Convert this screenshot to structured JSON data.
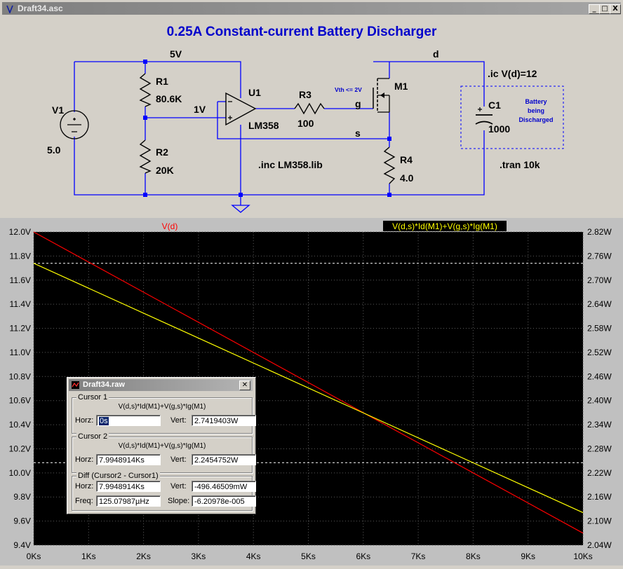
{
  "window": {
    "title": "Draft34.asc",
    "buttons": [
      "_",
      "□",
      "X"
    ]
  },
  "schematic": {
    "title": "0.25A Constant-current Battery Discharger",
    "labels": {
      "net_5v": "5V",
      "net_d": "d",
      "net_g": "g",
      "net_s": "s",
      "net_1v": "1V",
      "v1_name": "V1",
      "v1_value": "5.0",
      "r1_name": "R1",
      "r1_value": "80.6K",
      "r2_name": "R2",
      "r2_value": "20K",
      "u1_name": "U1",
      "u1_value": "LM358",
      "r3_name": "R3",
      "r3_value": "100",
      "m1_name": "M1",
      "vth_note": "Vth <= 2V",
      "r4_name": "R4",
      "r4_value": "4.0",
      "c1_name": "C1",
      "c1_value": "1000",
      "ic_directive": ".ic V(d)=12",
      "inc_directive": ".inc LM358.lib",
      "tran_directive": ".tran 10k",
      "battery_note_1": "Battery",
      "battery_note_2": "being",
      "battery_note_3": "Discharged"
    },
    "colors": {
      "wire": "#0000ff",
      "component": "#000000",
      "title": "#0000cc",
      "background": "#d4d0c8"
    }
  },
  "chart_data": {
    "type": "line",
    "x_ticks": [
      "0Ks",
      "1Ks",
      "2Ks",
      "3Ks",
      "4Ks",
      "5Ks",
      "6Ks",
      "7Ks",
      "8Ks",
      "9Ks",
      "10Ks"
    ],
    "x_range": [
      0,
      10
    ],
    "left_ticks": [
      "12.0V",
      "11.8V",
      "11.6V",
      "11.4V",
      "11.2V",
      "11.0V",
      "10.8V",
      "10.6V",
      "10.4V",
      "10.2V",
      "10.0V",
      "9.8V",
      "9.6V",
      "9.4V"
    ],
    "left_range": [
      9.4,
      12.0
    ],
    "right_ticks": [
      "2.82W",
      "2.76W",
      "2.70W",
      "2.64W",
      "2.58W",
      "2.52W",
      "2.46W",
      "2.40W",
      "2.34W",
      "2.28W",
      "2.22W",
      "2.16W",
      "2.10W",
      "2.04W"
    ],
    "right_range": [
      2.04,
      2.82
    ],
    "series": [
      {
        "name": "V(d)",
        "color": "#ff0000",
        "axis": "left",
        "x": [
          0,
          10
        ],
        "y": [
          12.0,
          9.5
        ]
      },
      {
        "name": "V(d,s)*Id(M1)+V(g,s)*Ig(M1)",
        "color": "#ffff00",
        "axis": "right",
        "x": [
          0,
          10
        ],
        "y": [
          2.742,
          2.121
        ]
      }
    ],
    "cursor_lines": [
      2.742,
      2.2455
    ],
    "grid": true,
    "background": "#000000"
  },
  "cursor_dialog": {
    "title": "Draft34.raw",
    "cursor1": {
      "label": "Cursor 1",
      "expr": "V(d,s)*Id(M1)+V(g,s)*Ig(M1)",
      "horz_label": "Horz:",
      "horz": "0s",
      "vert_label": "Vert:",
      "vert": "2.7419403W"
    },
    "cursor2": {
      "label": "Cursor 2",
      "expr": "V(d,s)*Id(M1)+V(g,s)*Ig(M1)",
      "horz_label": "Horz:",
      "horz": "7.9948914Ks",
      "vert_label": "Vert:",
      "vert": "2.2454752W"
    },
    "diff": {
      "label": "Diff (Cursor2 - Cursor1)",
      "horz_label": "Horz:",
      "horz": "7.9948914Ks",
      "vert_label": "Vert:",
      "vert": "-496.46509mW",
      "freq_label": "Freq:",
      "freq": "125.07987µHz",
      "slope_label": "Slope:",
      "slope": "-6.20978e-005"
    }
  }
}
